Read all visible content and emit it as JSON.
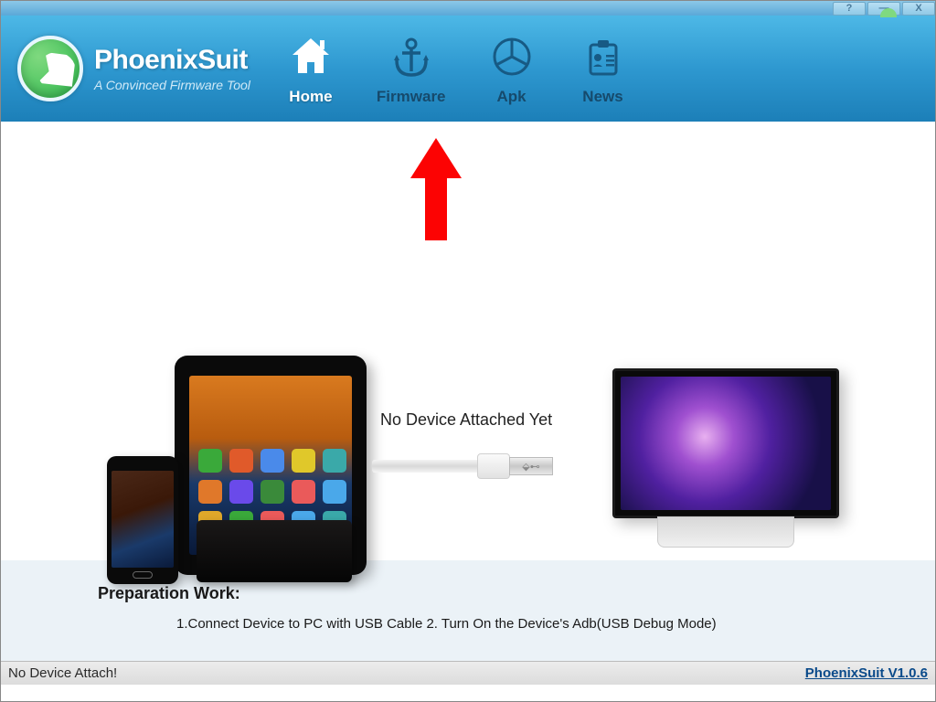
{
  "titlebar": {
    "help": "?",
    "minimize": "—",
    "close": "X"
  },
  "brand": {
    "name": "PhoenixSuit",
    "tagline": "A Convinced Firmware Tool"
  },
  "nav": {
    "home": "Home",
    "firmware": "Firmware",
    "apk": "Apk",
    "news": "News",
    "active": "home"
  },
  "content": {
    "status": "No Device Attached Yet"
  },
  "preparation": {
    "title": "Preparation Work:",
    "steps": "1.Connect Device to PC with USB Cable  2. Turn On the Device's Adb(USB Debug Mode)"
  },
  "statusbar": {
    "left": "No Device Attach!",
    "right": "PhoenixSuit V1.0.6"
  },
  "colors": {
    "header_top": "#4db8e6",
    "header_bottom": "#1c7fb8",
    "accent_green": "#2eb84d",
    "arrow": "#ff0000"
  }
}
